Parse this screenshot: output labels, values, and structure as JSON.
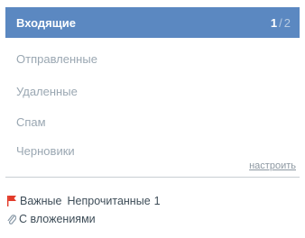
{
  "folders": {
    "inbox": {
      "label": "Входящие",
      "unread": "1",
      "sep": "/",
      "total": "2"
    },
    "sent": {
      "label": "Отправленные"
    },
    "deleted": {
      "label": "Удаленные"
    },
    "spam": {
      "label": "Спам"
    },
    "drafts": {
      "label": "Черновики"
    },
    "setup_link": "настроить"
  },
  "filters": {
    "important": "Важные",
    "unread": "Непрочитанные",
    "unread_count": "1",
    "attachments": "С вложениями"
  },
  "colors": {
    "active_bg": "#5b88c1",
    "flag": "#e23b2a"
  }
}
